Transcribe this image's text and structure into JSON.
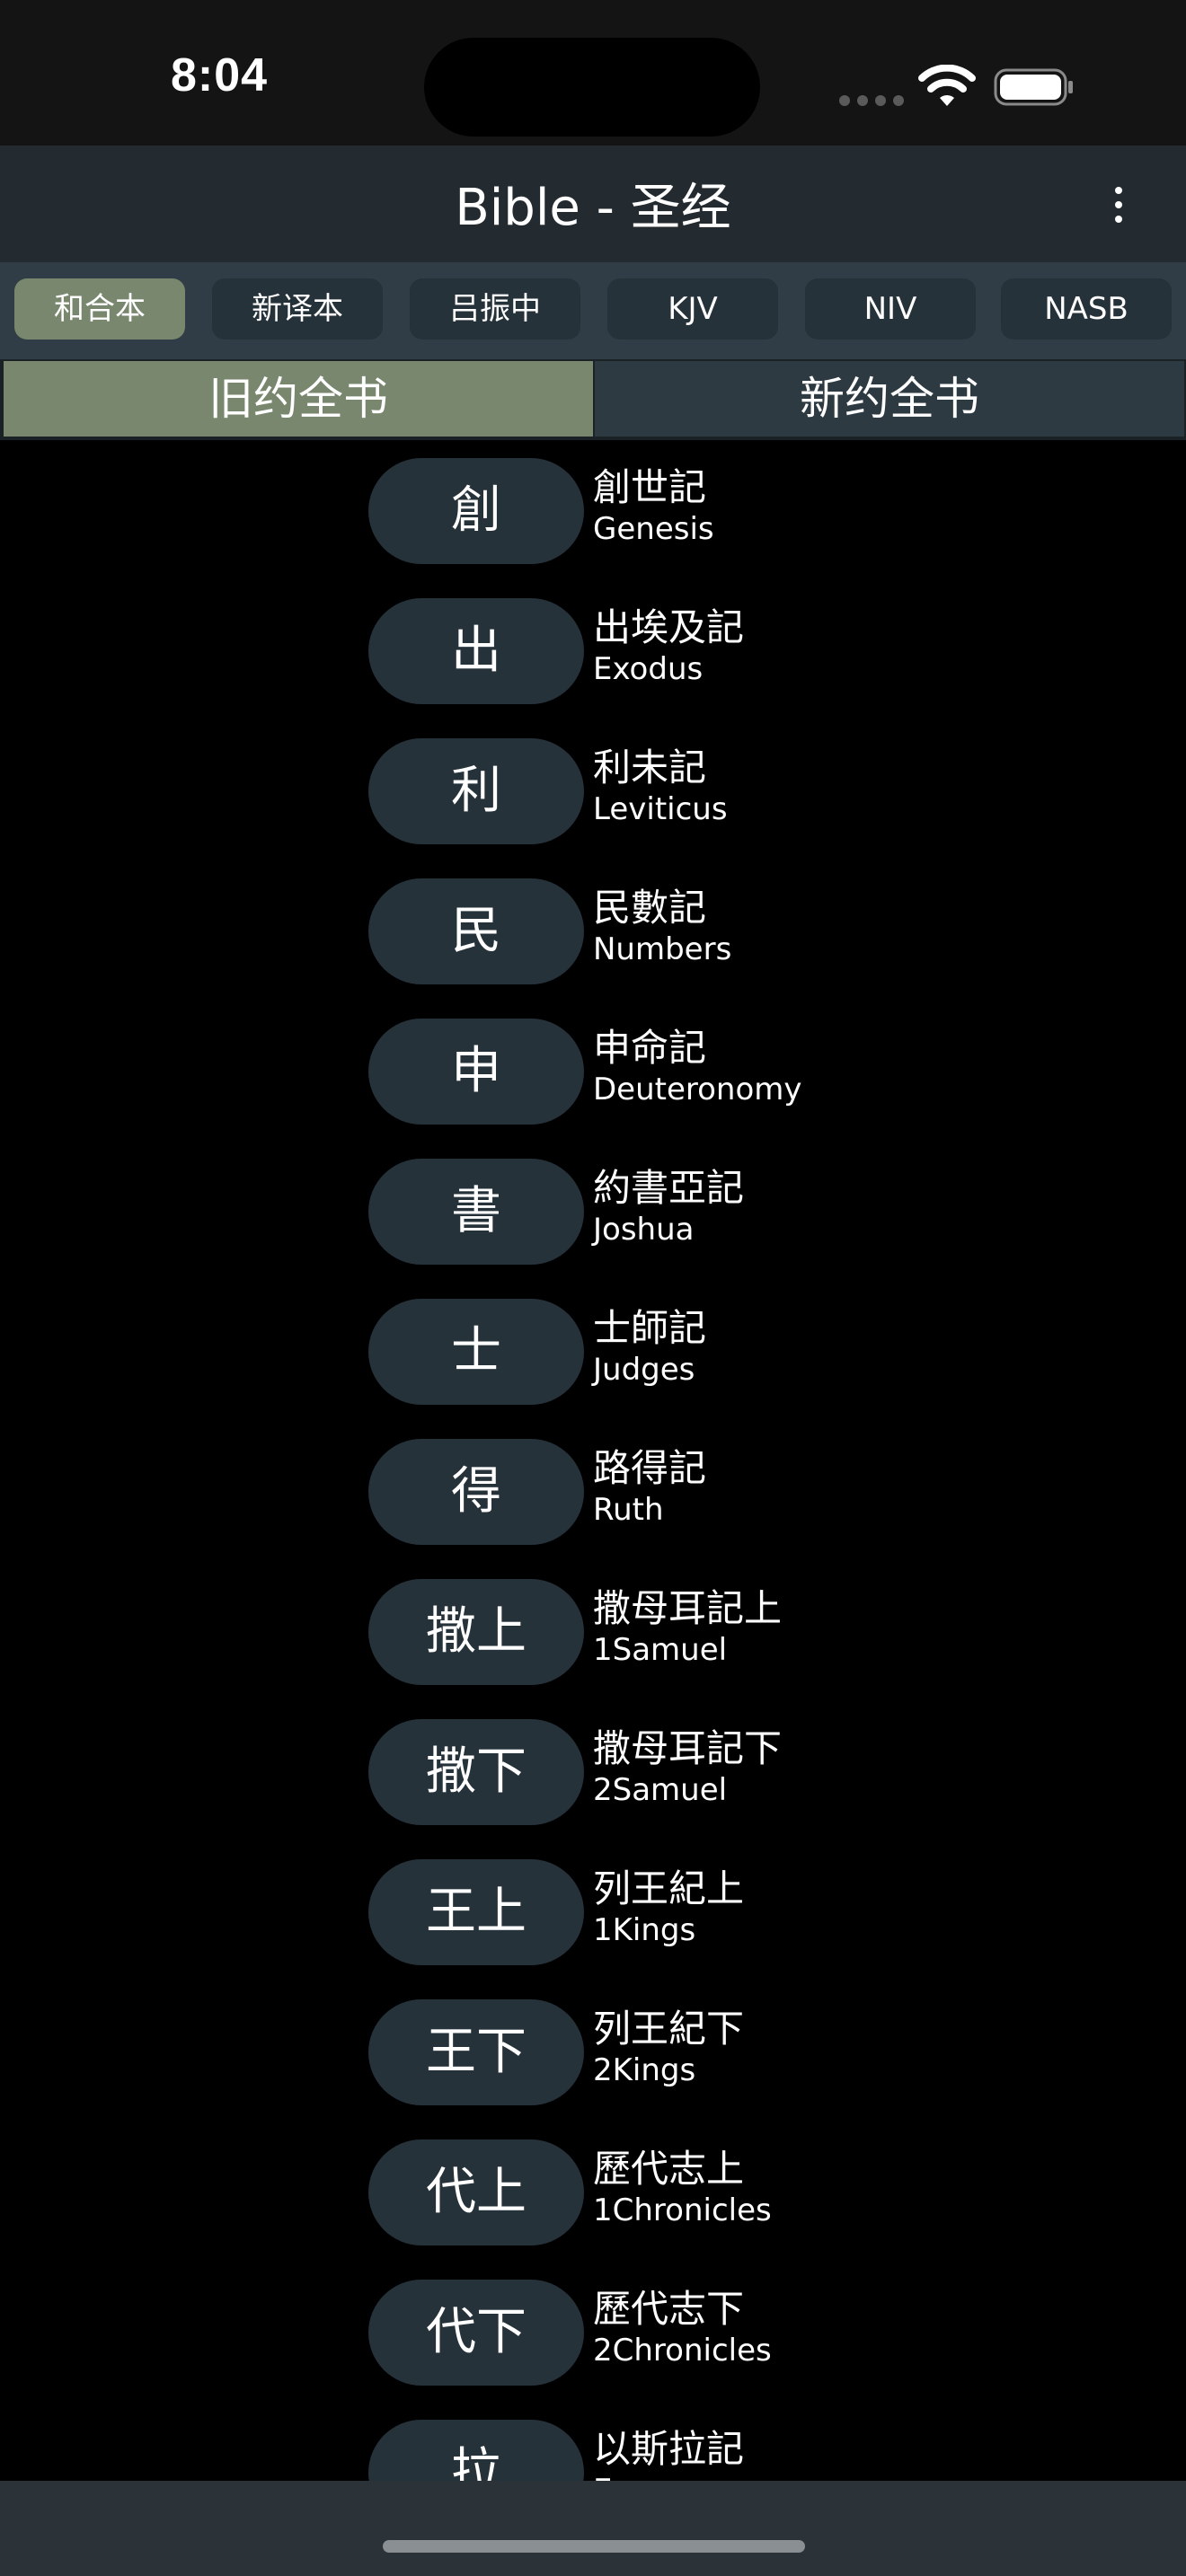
{
  "status_bar": {
    "time": "8:04",
    "icons": [
      "signal-icon",
      "wifi-icon",
      "battery-icon"
    ]
  },
  "header": {
    "title": "Bible - 圣经",
    "more_icon": "more-vertical-icon"
  },
  "versions": {
    "active_index": 0,
    "items": [
      {
        "label": "和合本"
      },
      {
        "label": "新译本"
      },
      {
        "label": "吕振中"
      },
      {
        "label": "KJV"
      },
      {
        "label": "NIV"
      },
      {
        "label": "NASB"
      }
    ]
  },
  "testaments": {
    "active_index": 0,
    "items": [
      {
        "label": "旧约全书"
      },
      {
        "label": "新约全书"
      }
    ]
  },
  "books": [
    {
      "abbr": "創",
      "name_zh": "創世記",
      "name_en": "Genesis"
    },
    {
      "abbr": "出",
      "name_zh": "出埃及記",
      "name_en": "Exodus"
    },
    {
      "abbr": "利",
      "name_zh": "利未記",
      "name_en": "Leviticus"
    },
    {
      "abbr": "民",
      "name_zh": "民數記",
      "name_en": "Numbers"
    },
    {
      "abbr": "申",
      "name_zh": "申命記",
      "name_en": "Deuteronomy"
    },
    {
      "abbr": "書",
      "name_zh": "約書亞記",
      "name_en": "Joshua"
    },
    {
      "abbr": "士",
      "name_zh": "士師記",
      "name_en": "Judges"
    },
    {
      "abbr": "得",
      "name_zh": "路得記",
      "name_en": "Ruth"
    },
    {
      "abbr": "撒上",
      "name_zh": "撒母耳記上",
      "name_en": "1Samuel"
    },
    {
      "abbr": "撒下",
      "name_zh": "撒母耳記下",
      "name_en": "2Samuel"
    },
    {
      "abbr": "王上",
      "name_zh": "列王紀上",
      "name_en": "1Kings"
    },
    {
      "abbr": "王下",
      "name_zh": "列王紀下",
      "name_en": "2Kings"
    },
    {
      "abbr": "代上",
      "name_zh": "歷代志上",
      "name_en": "1Chronicles"
    },
    {
      "abbr": "代下",
      "name_zh": "歷代志下",
      "name_en": "2Chronicles"
    },
    {
      "abbr": "拉",
      "name_zh": "以斯拉記",
      "name_en": "Ezra"
    }
  ],
  "colors": {
    "background": "#000000",
    "header": "#232b30",
    "accent_active": "#78876e",
    "pill": "#26323a"
  }
}
